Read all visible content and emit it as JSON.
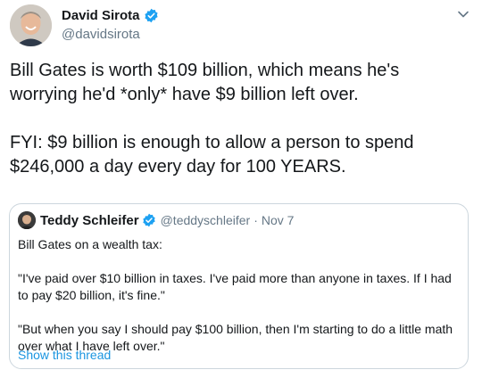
{
  "tweet": {
    "author_name": "David Sirota",
    "author_handle": "@davidsirota",
    "paragraphs": [
      "Bill Gates is worth $109 billion, which means he's worrying he'd *only* have $9 billion left over.",
      "FYI: $9 billion is enough to allow a person to spend $246,000 a day every day for 100 YEARS."
    ],
    "menu_icon": "chevron-down-icon"
  },
  "quoted_tweet": {
    "author_name": "Teddy Schleifer",
    "author_handle": "@teddyschleifer",
    "separator": "·",
    "date": "Nov 7",
    "paragraphs": [
      "Bill Gates on a wealth tax:",
      "\"I've paid over $10 billion in taxes. I've paid more than anyone in taxes. If I had to pay $20 billion, it's fine.\"",
      "\"But when you say I should pay $100 billion, then I'm starting to do a little math over what I have left over.\""
    ],
    "show_thread_label": "Show this thread"
  },
  "colors": {
    "accent": "#1b95e0",
    "verified": "#1da1f2",
    "secondary_text": "#657786",
    "border": "#ccd6dd"
  }
}
